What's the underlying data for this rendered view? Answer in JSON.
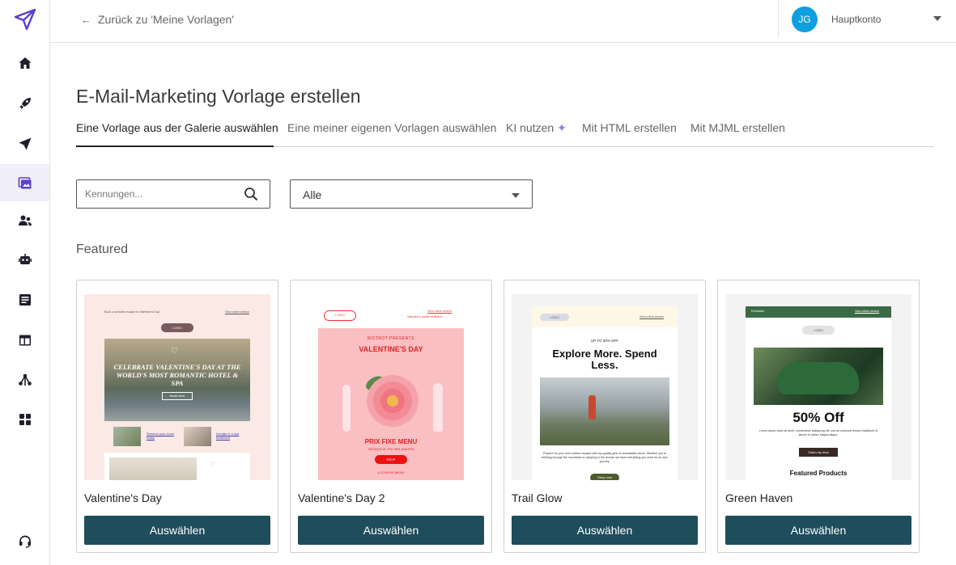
{
  "sidebar": {
    "items": [
      {
        "icon": "home-icon"
      },
      {
        "icon": "rocket-icon"
      },
      {
        "icon": "send-icon"
      },
      {
        "icon": "templates-icon",
        "active": true
      },
      {
        "icon": "contacts-icon"
      },
      {
        "icon": "robot-icon"
      },
      {
        "icon": "forms-icon"
      },
      {
        "icon": "layout-icon"
      },
      {
        "icon": "network-icon"
      },
      {
        "icon": "apps-icon"
      },
      {
        "icon": "support-icon"
      }
    ]
  },
  "topbar": {
    "back_label": "Zurück zu 'Meine Vorlagen'",
    "avatar_initials": "JG",
    "account_name": "Hauptkonto"
  },
  "page": {
    "title": "E-Mail-Marketing Vorlage erstellen",
    "tabs": [
      {
        "label": "Eine Vorlage aus der Galerie auswählen",
        "active": true
      },
      {
        "label": "Eine meiner eigenen Vorlagen auswählen"
      },
      {
        "label": "KI nutzen"
      },
      {
        "label": "Mit HTML erstellen"
      },
      {
        "label": "Mit MJML erstellen"
      }
    ],
    "search_placeholder": "Kennungen...",
    "filter_value": "Alle",
    "section_title": "Featured",
    "select_label": "Auswählen"
  },
  "cards": [
    {
      "name": "Valentine's Day",
      "preview": {
        "header_left": "Book a romantic escape for Valentine's Day!",
        "header_right": "View online version",
        "logo": "LOGO",
        "headline": "CELEBRATE VALENTINE'S DAY AT THE WORLD'S MOST ROMANTIC HOTEL & SPA",
        "cta": "Book Now",
        "link1": "Reserve your room today",
        "link2": "Indulge in a spa treatment"
      }
    },
    {
      "name": "Valentine's Day 2",
      "preview": {
        "logo": "LOGO",
        "header_right": "View online version",
        "header_right2": "Valentine's prefixe at Bistrot",
        "kicker": "BISTROT PRESENTS",
        "headline": "VALENTINE'S DAY",
        "menu": "PRIX FIXE MENU",
        "times": "SEATINGS AT 7PM, 8PM, AND 9PM",
        "cta": "RSVP",
        "footer": "4 COURSE MENU"
      }
    },
    {
      "name": "Trail Glow",
      "preview": {
        "logo": "LOGO",
        "header_right": "View online version",
        "kicker": "UP TO 30% OFF",
        "headline": "Explore More. Spend Less.",
        "body": "Prepare for your next outdoor escape with top-quality gear at unbeatable prices. Whether you're trekking through the mountains or camping in the woods, we have everything you need for an epic journey.",
        "cta": "Shop now"
      }
    },
    {
      "name": "Green Haven",
      "preview": {
        "header_left": "Preheader",
        "header_right": "View online version",
        "logo": "LOGO",
        "headline": "50% Off",
        "body": "Lorem ipsum dolor sit amet, consectetur adipiscing elit, sed do eiusmod tempor incididunt ut labore et dolore magna aliqua.",
        "cta": "Claim my deal",
        "footer": "Featured Products"
      }
    }
  ],
  "colors": {
    "accent": "#1e4d5c",
    "brand": "#5b3fd1",
    "avatar": "#0d9fe0"
  }
}
